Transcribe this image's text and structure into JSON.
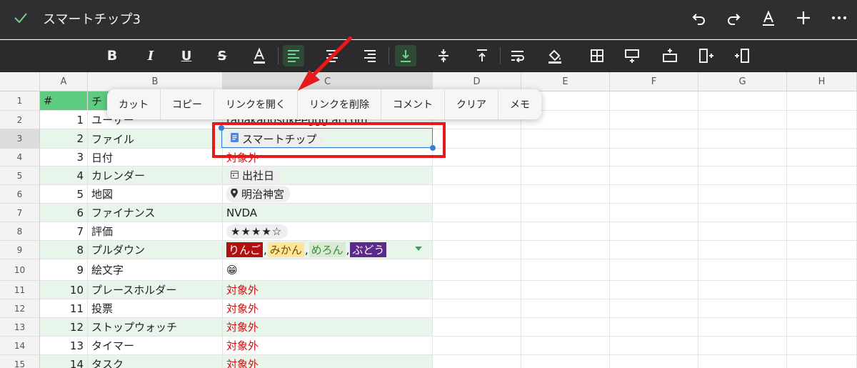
{
  "app": {
    "title": "スマートチップ3"
  },
  "context_menu": [
    "カット",
    "コピー",
    "リンクを開く",
    "リンクを削除",
    "コメント",
    "クリア",
    "メモ"
  ],
  "columns": [
    "A",
    "B",
    "C",
    "D",
    "E",
    "F",
    "G",
    "H"
  ],
  "rows": [
    {
      "n": "1",
      "a": "#",
      "b": "チ",
      "c": "",
      "kind": "header"
    },
    {
      "n": "2",
      "a": "1",
      "b": "ユーザー",
      "c": "tanakanosukeeggg.ai.com",
      "kind": "text"
    },
    {
      "n": "3",
      "a": "2",
      "b": "ファイル",
      "c": "スマートチップ",
      "kind": "file-chip"
    },
    {
      "n": "4",
      "a": "3",
      "b": "日付",
      "c": "対象外",
      "kind": "red"
    },
    {
      "n": "5",
      "a": "4",
      "b": "カレンダー",
      "c": "出社日",
      "kind": "calendar-chip"
    },
    {
      "n": "6",
      "a": "5",
      "b": "地図",
      "c": "明治神宮",
      "kind": "map-chip"
    },
    {
      "n": "7",
      "a": "6",
      "b": "ファイナンス",
      "c": "NVDA",
      "kind": "text"
    },
    {
      "n": "8",
      "a": "7",
      "b": "評価",
      "c": "★★★★☆",
      "kind": "rating"
    },
    {
      "n": "9",
      "a": "8",
      "b": "プルダウン",
      "c": "",
      "kind": "dropdown"
    },
    {
      "n": "10",
      "a": "9",
      "b": "絵文字",
      "c": "😁",
      "kind": "emoji"
    },
    {
      "n": "11",
      "a": "10",
      "b": "プレースホルダー",
      "c": "対象外",
      "kind": "red"
    },
    {
      "n": "12",
      "a": "11",
      "b": "投票",
      "c": "対象外",
      "kind": "red"
    },
    {
      "n": "13",
      "a": "12",
      "b": "ストップウォッチ",
      "c": "対象外",
      "kind": "red"
    },
    {
      "n": "14",
      "a": "13",
      "b": "タイマー",
      "c": "対象外",
      "kind": "red"
    },
    {
      "n": "15",
      "a": "14",
      "b": "タスク",
      "c": "対象外",
      "kind": "red"
    }
  ],
  "dropdown_tags": [
    {
      "text": "りんご",
      "bg": "#b01010",
      "fg": "#ffffff"
    },
    {
      "text": "みかん",
      "bg": "#ffe599",
      "fg": "#6b5200"
    },
    {
      "text": "めろん",
      "bg": "#d9ead3",
      "fg": "#3a8a3a"
    },
    {
      "text": "ぶどう",
      "bg": "#5b2a8a",
      "fg": "#ffffff"
    }
  ],
  "colors": {
    "accent": "#5dcc81",
    "highlight": "#e51b1b",
    "selection": "#3d7bd9"
  }
}
